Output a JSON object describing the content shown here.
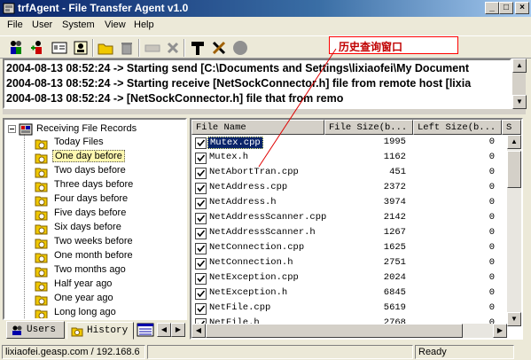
{
  "window": {
    "title": "trfAgent - File Transfer Agent v1.0",
    "controls": [
      "_",
      "□",
      "×"
    ]
  },
  "menu": [
    "File",
    "User",
    "System",
    "View",
    "Help"
  ],
  "toolbar": {
    "buttons": [
      "users-icon",
      "add-user-icon",
      "user-card-icon",
      "settings-card-icon",
      "open-folder-icon",
      "trash-icon",
      "disabled-icon",
      "cancel-icon",
      "hammer-icon",
      "tools-icon",
      "stop-icon"
    ]
  },
  "annotation": "历史查询窗口",
  "log": [
    "2004-08-13 08:52:24 -> Starting send [C:\\Documents and Settings\\lixiaofei\\My Document",
    "2004-08-13 08:52:24 -> Starting receive [NetSockConnector.h] file from remote host [lixia",
    "2004-08-13 08:52:24 -> [NetSockConnector.h] file that from remo"
  ],
  "tree": {
    "root": "Receiving File Records",
    "items": [
      "Today Files",
      "One day before",
      "Two days before",
      "Three days before",
      "Four days before",
      "Five days before",
      "Six days before",
      "Two weeks before",
      "One month before",
      "Two months ago",
      "Half year ago",
      "One year ago",
      "Long long ago"
    ],
    "selected": "One day before"
  },
  "tabs": [
    "Users",
    "History"
  ],
  "list": {
    "columns": [
      "File Name",
      "File Size(b...",
      "Left Size(b...",
      "S"
    ],
    "rows": [
      {
        "name": "Mutex.cpp",
        "size": "1995",
        "left": "0"
      },
      {
        "name": "Mutex.h",
        "size": "1162",
        "left": "0"
      },
      {
        "name": "NetAbortTran.cpp",
        "size": "451",
        "left": "0"
      },
      {
        "name": "NetAddress.cpp",
        "size": "2372",
        "left": "0"
      },
      {
        "name": "NetAddress.h",
        "size": "3974",
        "left": "0"
      },
      {
        "name": "NetAddressScanner.cpp",
        "size": "2142",
        "left": "0"
      },
      {
        "name": "NetAddressScanner.h",
        "size": "1267",
        "left": "0"
      },
      {
        "name": "NetConnection.cpp",
        "size": "1625",
        "left": "0"
      },
      {
        "name": "NetConnection.h",
        "size": "2751",
        "left": "0"
      },
      {
        "name": "NetException.cpp",
        "size": "2024",
        "left": "0"
      },
      {
        "name": "NetException.h",
        "size": "6845",
        "left": "0"
      },
      {
        "name": "NetFile.cpp",
        "size": "5619",
        "left": "0"
      },
      {
        "name": "NetFile.h",
        "size": "2768",
        "left": "0"
      }
    ],
    "selected_index": 0
  },
  "status": {
    "user": "lixiaofei.geasp.com / 192.168.6",
    "state": "Ready"
  }
}
